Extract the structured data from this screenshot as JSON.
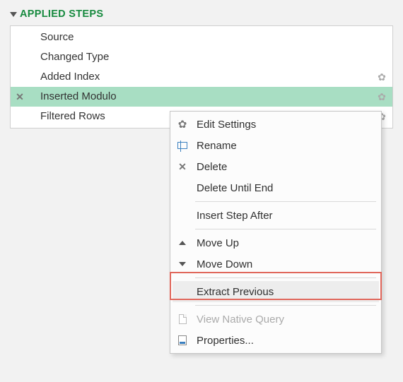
{
  "header": {
    "title": "APPLIED STEPS"
  },
  "steps": [
    {
      "label": "Source",
      "has_gear": false,
      "has_x": false,
      "selected": false
    },
    {
      "label": "Changed Type",
      "has_gear": false,
      "has_x": false,
      "selected": false
    },
    {
      "label": "Added Index",
      "has_gear": true,
      "has_x": false,
      "selected": false
    },
    {
      "label": "Inserted Modulo",
      "has_gear": true,
      "has_x": true,
      "selected": true
    },
    {
      "label": "Filtered Rows",
      "has_gear": true,
      "has_x": false,
      "selected": false
    }
  ],
  "context_menu": {
    "items": [
      {
        "icon": "gear-icon",
        "label": "Edit Settings",
        "enabled": true
      },
      {
        "icon": "rename-icon",
        "label": "Rename",
        "enabled": true
      },
      {
        "icon": "x-icon",
        "label": "Delete",
        "enabled": true
      },
      {
        "icon": "",
        "label": "Delete Until End",
        "enabled": true
      }
    ],
    "items2": [
      {
        "icon": "",
        "label": "Insert Step After",
        "enabled": true
      }
    ],
    "items3": [
      {
        "icon": "chev-up",
        "label": "Move Up",
        "enabled": true
      },
      {
        "icon": "chev-dn",
        "label": "Move Down",
        "enabled": true
      }
    ],
    "items4": [
      {
        "icon": "",
        "label": "Extract Previous",
        "enabled": true,
        "highlight": true
      }
    ],
    "items5": [
      {
        "icon": "doc-icon",
        "label": "View Native Query",
        "enabled": false
      },
      {
        "icon": "props-icon",
        "label": "Properties...",
        "enabled": true
      }
    ]
  }
}
